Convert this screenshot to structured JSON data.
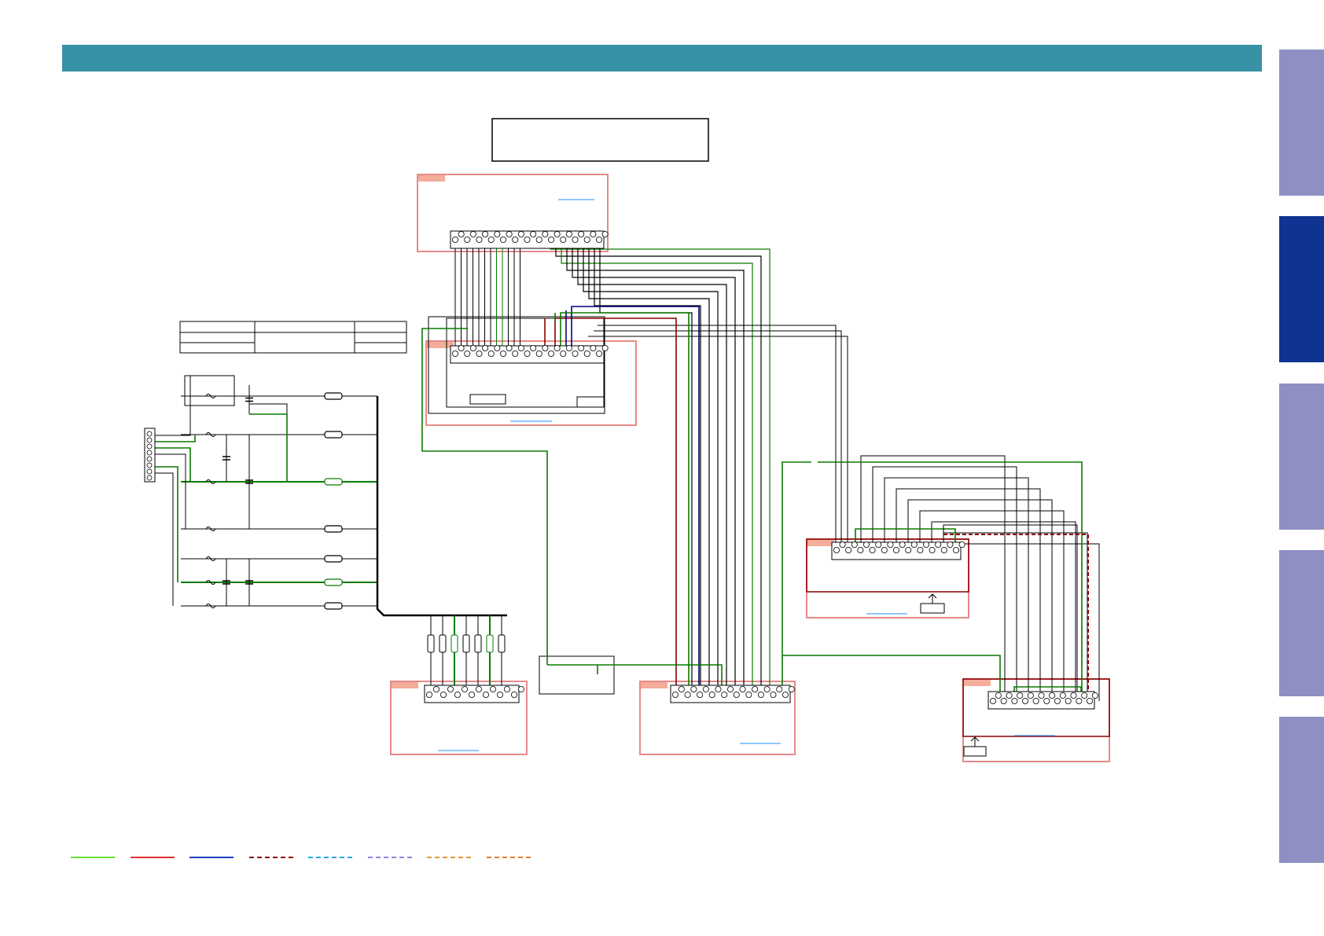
{
  "header": {
    "title": ""
  },
  "colors": {
    "header": "#3792a6",
    "tab": "#8f8fc4",
    "tab_active": "#0f3392",
    "wire_black": "#000000",
    "wire_green": "#0a7a00",
    "wire_red": "#8b0000",
    "wire_blue": "#000080",
    "pcb_outline": "#e88a8a",
    "pcb_label": "#f3ad9a",
    "link": "#1e90ff"
  },
  "side_tabs": [
    {
      "label": "",
      "active": false
    },
    {
      "label": "",
      "active": true
    },
    {
      "label": "",
      "active": false
    },
    {
      "label": "",
      "active": false
    },
    {
      "label": "",
      "active": false
    }
  ],
  "legend": [
    {
      "label": "",
      "color": "#66e03a",
      "style": "solid"
    },
    {
      "label": "",
      "color": "#e03030",
      "style": "solid"
    },
    {
      "label": "",
      "color": "#1f3fbf",
      "style": "solid"
    },
    {
      "label": "",
      "color": "#8b1010",
      "style": "dashed"
    },
    {
      "label": "",
      "color": "#2aa8e0",
      "style": "dashed"
    },
    {
      "label": "",
      "color": "#8a86d8",
      "style": "dashed"
    },
    {
      "label": "",
      "color": "#e09a40",
      "style": "dashed"
    },
    {
      "label": "",
      "color": "#e07a30",
      "style": "dashed"
    }
  ],
  "boards": [
    {
      "name": "board-top",
      "label": ""
    },
    {
      "name": "board-middle-left",
      "label": ""
    },
    {
      "name": "board-bottom-left",
      "label": ""
    },
    {
      "name": "board-bottom-center",
      "label": ""
    },
    {
      "name": "board-right-upper",
      "label": ""
    },
    {
      "name": "board-right-lower",
      "label": ""
    }
  ]
}
